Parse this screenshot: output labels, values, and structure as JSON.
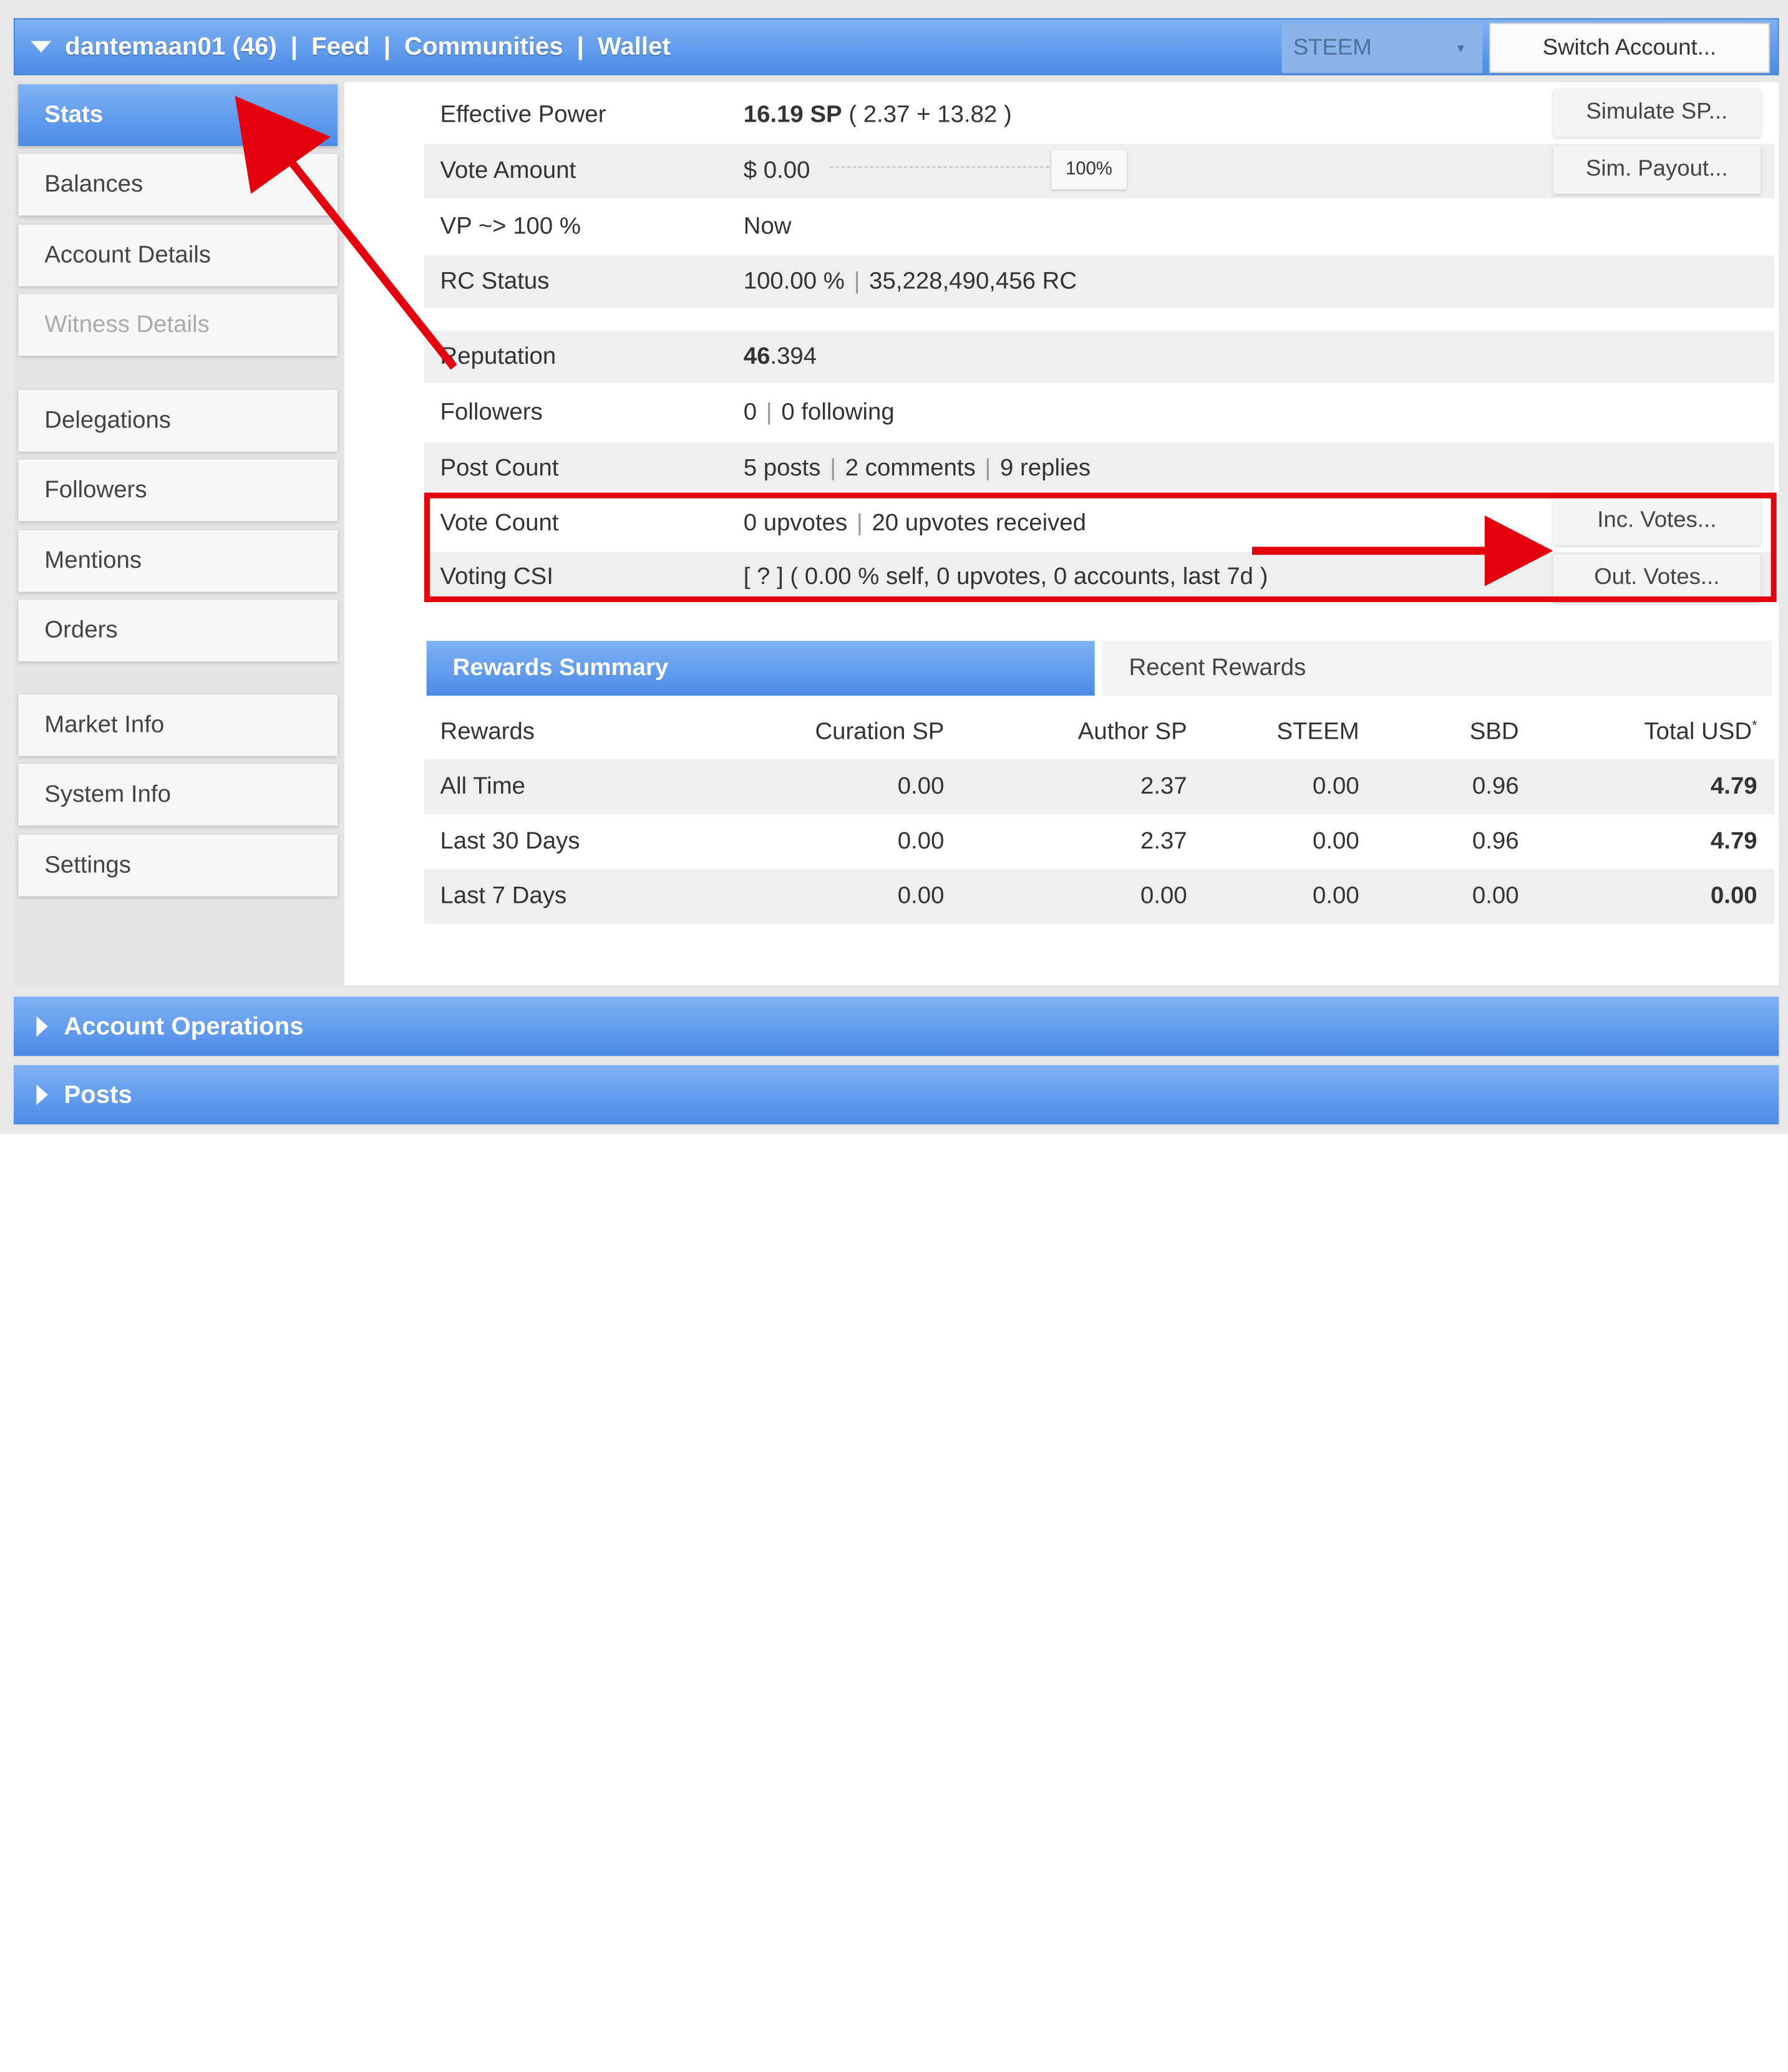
{
  "header": {
    "account": "dantemaan01 (46)",
    "links": [
      "Feed",
      "Communities",
      "Wallet"
    ],
    "separator": "|",
    "currency_select": "STEEM",
    "switch_button": "Switch Account..."
  },
  "sidebar": {
    "items": [
      {
        "label": "Stats",
        "state": "active"
      },
      {
        "label": "Balances"
      },
      {
        "label": "Account Details"
      },
      {
        "label": "Witness Details",
        "state": "disabled"
      },
      {
        "label": "Delegations"
      },
      {
        "label": "Followers"
      },
      {
        "label": "Mentions"
      },
      {
        "label": "Orders"
      },
      {
        "label": "Market Info"
      },
      {
        "label": "System Info"
      },
      {
        "label": "Settings"
      }
    ]
  },
  "stats": {
    "effective_power": {
      "label": "Effective Power",
      "value": "16.19 SP",
      "detail": "( 2.37 + 13.82 )",
      "button": "Simulate SP..."
    },
    "vote_amount": {
      "label": "Vote Amount",
      "value": "$ 0.00",
      "percent": "100%",
      "button": "Sim. Payout..."
    },
    "vp": {
      "label": "VP ~> 100 %",
      "value": "Now"
    },
    "rc": {
      "label": "RC Status",
      "value1": "100.00 %",
      "value2": "35,228,490,456 RC"
    },
    "reputation": {
      "label": "Reputation",
      "value_bold": "46",
      "value_rest": ".394"
    },
    "followers": {
      "label": "Followers",
      "value1": "0",
      "value2": "0 following"
    },
    "post_count": {
      "label": "Post Count",
      "value1": "5 posts",
      "value2": "2 comments",
      "value3": "9 replies"
    },
    "vote_count": {
      "label": "Vote Count",
      "value1": "0 upvotes",
      "value2": "20 upvotes received",
      "button": "Inc. Votes..."
    },
    "voting_csi": {
      "label": "Voting CSI",
      "value": "[ ? ] ( 0.00 % self, 0 upvotes, 0 accounts, last 7d )",
      "button": "Out. Votes..."
    }
  },
  "rewards": {
    "tabs": [
      "Rewards Summary",
      "Recent Rewards"
    ],
    "columns": [
      "Rewards",
      "Curation SP",
      "Author SP",
      "STEEM",
      "SBD",
      "Total USD"
    ],
    "total_mark": "*",
    "rows": [
      [
        "All Time",
        "0.00",
        "2.37",
        "0.00",
        "0.96",
        "4.79"
      ],
      [
        "Last 30 Days",
        "0.00",
        "2.37",
        "0.00",
        "0.96",
        "4.79"
      ],
      [
        "Last 7 Days",
        "0.00",
        "0.00",
        "0.00",
        "0.00",
        "0.00"
      ]
    ]
  },
  "sections": [
    "Account Operations",
    "Posts"
  ],
  "colors": {
    "accent_blue": "#4b8be6",
    "annotation_red": "#e3000f"
  }
}
